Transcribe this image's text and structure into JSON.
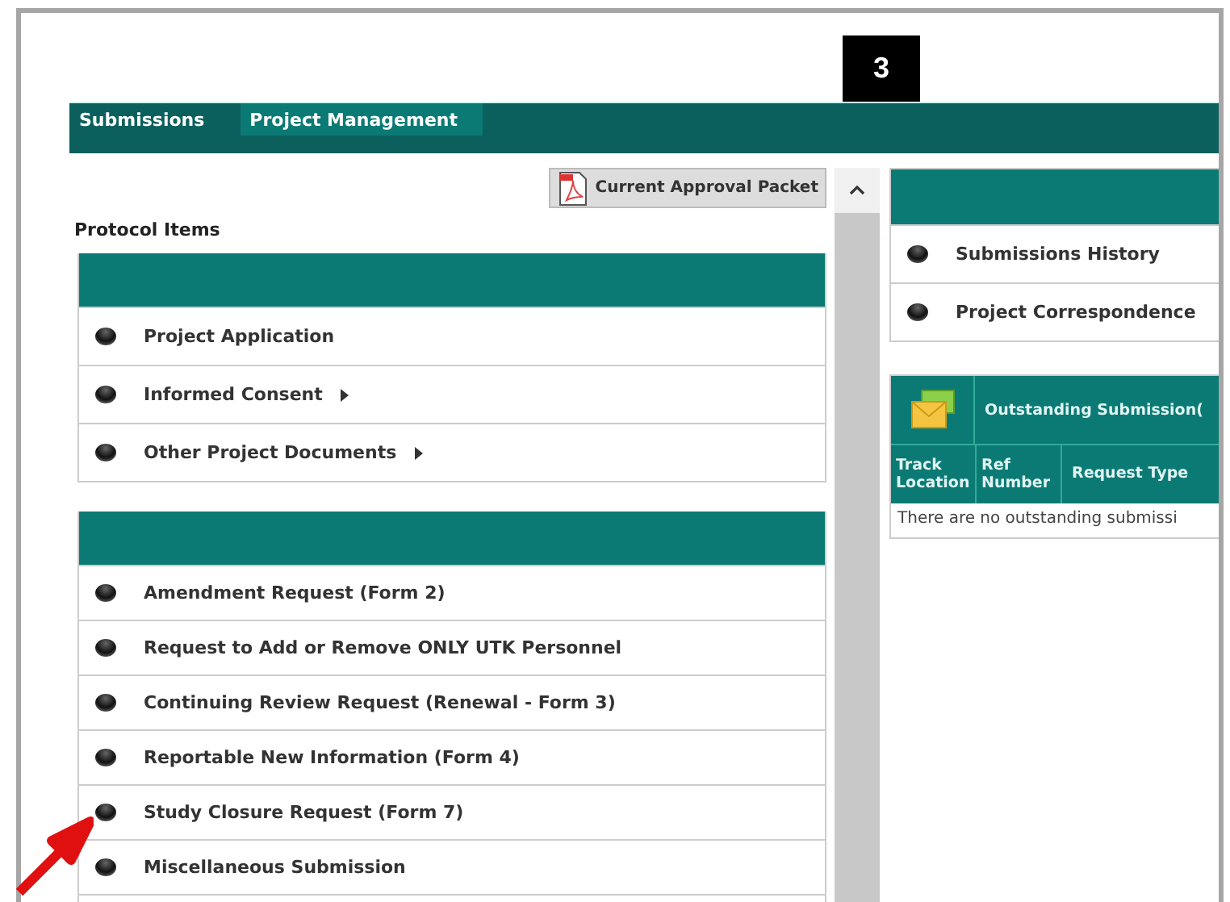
{
  "badge": "3",
  "tabs": [
    {
      "label": "Submissions",
      "selected": true
    },
    {
      "label": "Project Management",
      "selected": false
    }
  ],
  "packet_button": "Current Approval Packet",
  "protocol_title": "Protocol Items",
  "protocol_items": [
    {
      "label": "Project Application",
      "has_submenu": false
    },
    {
      "label": "Informed Consent",
      "has_submenu": true
    },
    {
      "label": "Other Project Documents",
      "has_submenu": true
    }
  ],
  "submission_items": [
    {
      "label": "Amendment Request (Form 2)",
      "has_submenu": false
    },
    {
      "label": "Request to Add or Remove ONLY UTK Personnel",
      "has_submenu": false
    },
    {
      "label": "Continuing Review Request (Renewal - Form 3)",
      "has_submenu": false
    },
    {
      "label": "Reportable New Information (Form 4)",
      "has_submenu": false
    },
    {
      "label": "Study Closure Request (Form 7)",
      "has_submenu": false
    },
    {
      "label": "Miscellaneous Submission",
      "has_submenu": false
    }
  ],
  "right_links": [
    {
      "label": "Submissions History"
    },
    {
      "label": "Project Correspondence"
    }
  ],
  "outstanding": {
    "title": "Outstanding Submission(",
    "columns": [
      "Track Location",
      "Ref Number",
      "Request Type"
    ],
    "empty_message": "There are no outstanding submissi"
  }
}
